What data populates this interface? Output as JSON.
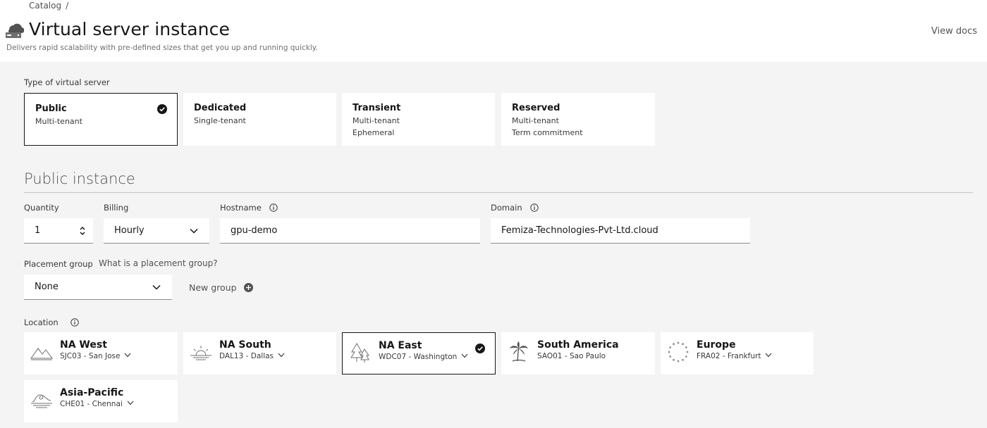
{
  "breadcrumb": {
    "item": "Catalog",
    "separator": "/"
  },
  "header": {
    "title": "Virtual server instance",
    "subtitle": "Delivers rapid scalability with pre-defined sizes that get you up and running quickly.",
    "view_docs": "View docs",
    "icon": "cloud-server-icon"
  },
  "server_type": {
    "label": "Type of virtual server",
    "options": [
      {
        "title": "Public",
        "lines": [
          "Multi-tenant"
        ],
        "selected": true
      },
      {
        "title": "Dedicated",
        "lines": [
          "Single-tenant"
        ],
        "selected": false
      },
      {
        "title": "Transient",
        "lines": [
          "Multi-tenant",
          "Ephemeral"
        ],
        "selected": false
      },
      {
        "title": "Reserved",
        "lines": [
          "Multi-tenant",
          "Term commitment"
        ],
        "selected": false
      }
    ]
  },
  "section": {
    "title": "Public instance"
  },
  "form": {
    "quantity": {
      "label": "Quantity",
      "value": "1"
    },
    "billing": {
      "label": "Billing",
      "value": "Hourly"
    },
    "hostname": {
      "label": "Hostname",
      "value": "gpu-demo"
    },
    "domain": {
      "label": "Domain",
      "value": "Femiza-Technologies-Pvt-Ltd.cloud"
    },
    "placement_group": {
      "label": "Placement group",
      "help_link": "What is a placement group?",
      "value": "None",
      "new_group": "New group"
    }
  },
  "location": {
    "label": "Location",
    "regions": [
      {
        "title": "NA West",
        "datacenter": "SJC03 - San Jose",
        "icon": "mountains-icon",
        "selected": false,
        "expandable": true
      },
      {
        "title": "NA South",
        "datacenter": "DAL13 - Dallas",
        "icon": "sunrise-icon",
        "selected": false,
        "expandable": true
      },
      {
        "title": "NA East",
        "datacenter": "WDC07 - Washington",
        "icon": "pine-trees-icon",
        "selected": true,
        "expandable": true
      },
      {
        "title": "South America",
        "datacenter": "SAO01 - Sao Paulo",
        "icon": "palm-tree-icon",
        "selected": false,
        "expandable": false
      },
      {
        "title": "Europe",
        "datacenter": "FRA02 - Frankfurt",
        "icon": "eu-stars-icon",
        "selected": false,
        "expandable": true
      },
      {
        "title": "Asia-Pacific",
        "datacenter": "CHE01 - Chennai",
        "icon": "wave-icon",
        "selected": false,
        "expandable": true
      }
    ]
  },
  "colors": {
    "selected_border": "#161616",
    "tile_bg": "#ffffff",
    "page_bg": "#f4f4f4"
  }
}
